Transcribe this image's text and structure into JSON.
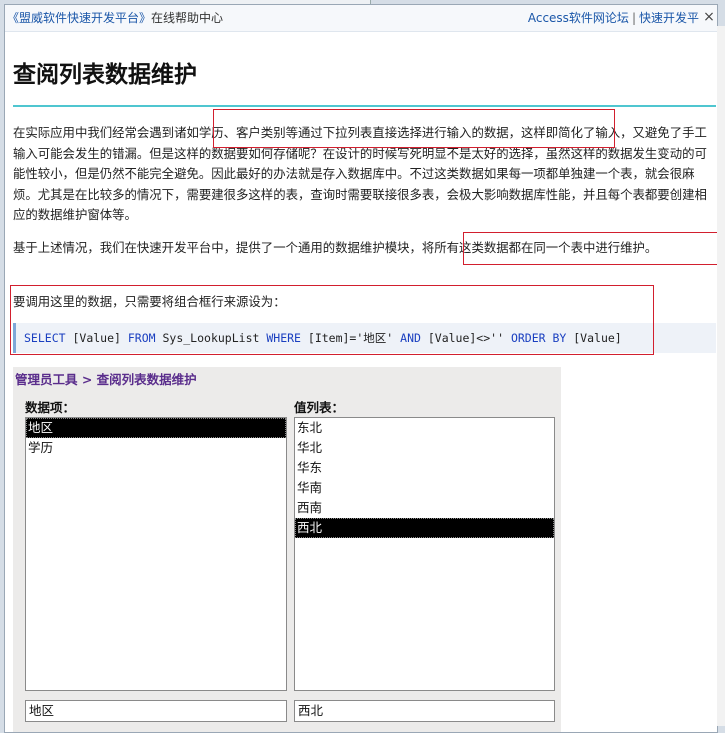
{
  "backdrop": {
    "partial_text": "…"
  },
  "topbar": {
    "left_link": "《盟威软件快速开发平台》",
    "left_text": "在线帮助中心",
    "right_link1": "Access软件网论坛",
    "separator": "|",
    "right_link2": "快速开发平台",
    "close_glyph": "×"
  },
  "page": {
    "title": "查阅列表数据维护",
    "para1": "在实际应用中我们经常会遇到诸如学历、客户类别等通过下拉列表直接选择进行输入的数据，这样即简化了输入，又避免了手工输入可能会发生的错漏。但是这样的数据要如何存储呢？在设计的时候写死明显不是太好的选择，虽然这样的数据发生变动的可能性较小，但是仍然不能完全避免。因此最好的办法就是存入数据库中。不过这类数据如果每一项都单独建一个表，就会很麻烦。尤其是在比较多的情况下，需要建很多这样的表，查询时需要联接很多表，会极大影响数据库性能，并且每个表都要创建相应的数据维护窗体等。",
    "para2": "基于上述情况，我们在快速开发平台中，提供了一个通用的数据维护模块，将所有这类数据都在同一个表中进行维护。",
    "para3": "要调用这里的数据，只需要将组合框行来源设为：",
    "code": {
      "kw1": "SELECT",
      "t1": " [Value] ",
      "kw2": "FROM",
      "t2": " Sys_LookupList ",
      "kw3": "WHERE",
      "t3": " [Item]='地区' ",
      "kw4": "AND",
      "t4": " [Value]<>'' ",
      "kw5": "ORDER BY",
      "t5": " [Value]"
    }
  },
  "panel": {
    "breadcrumb": "管理员工具 > 查阅列表数据维护",
    "items_label": "数据项：",
    "values_label": "值列表：",
    "items": [
      "地区",
      "学历"
    ],
    "selected_item": "地区",
    "values": [
      "东北",
      "华北",
      "华东",
      "华南",
      "西南",
      "西北"
    ],
    "selected_value": "西北",
    "item_input": "地区",
    "value_input": "西北"
  }
}
